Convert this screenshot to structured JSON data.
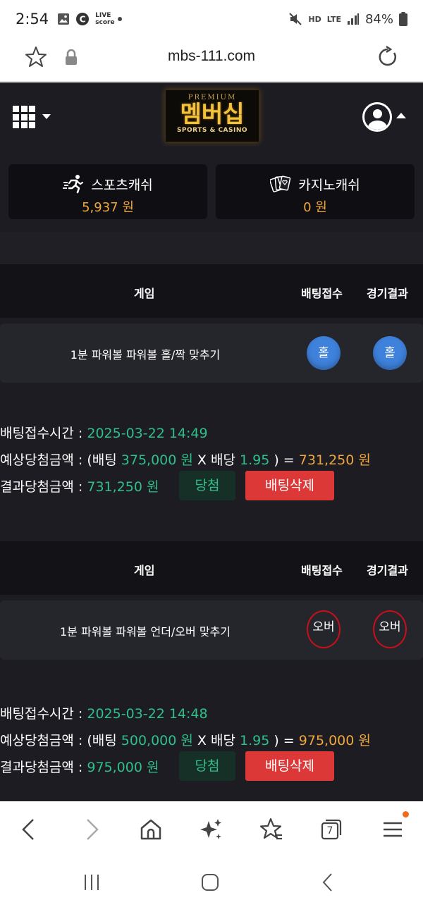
{
  "status_bar": {
    "time": "2:54",
    "icons": [
      "gallery-icon",
      "c-app-icon",
      "live-score-icon",
      "dot-icon"
    ],
    "live_score_label": "LIVE score",
    "right_icons": [
      "mute-icon",
      "hd-voice-icon",
      "lte-icon",
      "signal-icon"
    ],
    "hd_label": "HD",
    "lte_label": "LTE",
    "battery": "84%"
  },
  "browser": {
    "url": "mbs-111.com",
    "icons": [
      "star-icon",
      "lock-icon",
      "reload-icon"
    ]
  },
  "header": {
    "logo_premium": "PREMIUM",
    "logo_name": "멤버십",
    "logo_sub": "SPORTS & CASINO"
  },
  "cash": {
    "sports": {
      "label": "스포츠캐쉬",
      "value": "5,937 원",
      "icon": "running-man-icon"
    },
    "casino": {
      "label": "카지노캐쉬",
      "value": "0 원",
      "icon": "playing-cards-icon"
    }
  },
  "colors": {
    "accent_gold": "#f0a63b",
    "accent_green": "#2ec089",
    "pick_blue": "#3e82dc",
    "delete_red": "#dc3838",
    "ring_red": "#c8101c"
  },
  "bets": [
    {
      "headers": {
        "game": "게임",
        "bet": "배팅접수",
        "result": "경기결과"
      },
      "game_name": "1분 파워볼 파워볼 홀/짝 맞추기",
      "pick": "홀",
      "result": "홀",
      "pick_style": "blue",
      "time_label": "배팅접수시간 :",
      "time_value": "2025-03-22 14:49",
      "expected_label": "예상당첨금액 : (배팅",
      "bet_amount": "375,000 원",
      "x_label": "X 배당",
      "odds": "1.95",
      "eq_label": ") =",
      "expected_amount": "731,250 원",
      "result_label": "결과당첨금액 :",
      "result_amount": "731,250 원",
      "status": "당첨",
      "delete_label": "배팅삭제"
    },
    {
      "headers": {
        "game": "게임",
        "bet": "배팅접수",
        "result": "경기결과"
      },
      "game_name": "1분 파워볼 파워볼 언더/오버 맞추기",
      "pick": "오버",
      "result": "오버",
      "pick_style": "ring",
      "time_label": "배팅접수시간 :",
      "time_value": "2025-03-22 14:48",
      "expected_label": "예상당첨금액 : (배팅",
      "bet_amount": "500,000 원",
      "x_label": "X 배당",
      "odds": "1.95",
      "eq_label": ") =",
      "expected_amount": "975,000 원",
      "result_label": "결과당첨금액 :",
      "result_amount": "975,000 원",
      "status": "당첨",
      "delete_label": "배팅삭제"
    }
  ],
  "toolbar": {
    "tabs_count": "7",
    "icons": [
      "back-icon",
      "forward-icon",
      "home-icon",
      "ai-sparkle-icon",
      "bookmarks-icon",
      "tabs-icon",
      "menu-icon"
    ]
  },
  "navbar": {
    "icons": [
      "recent-apps-icon",
      "home-nav-icon",
      "back-nav-icon"
    ]
  }
}
